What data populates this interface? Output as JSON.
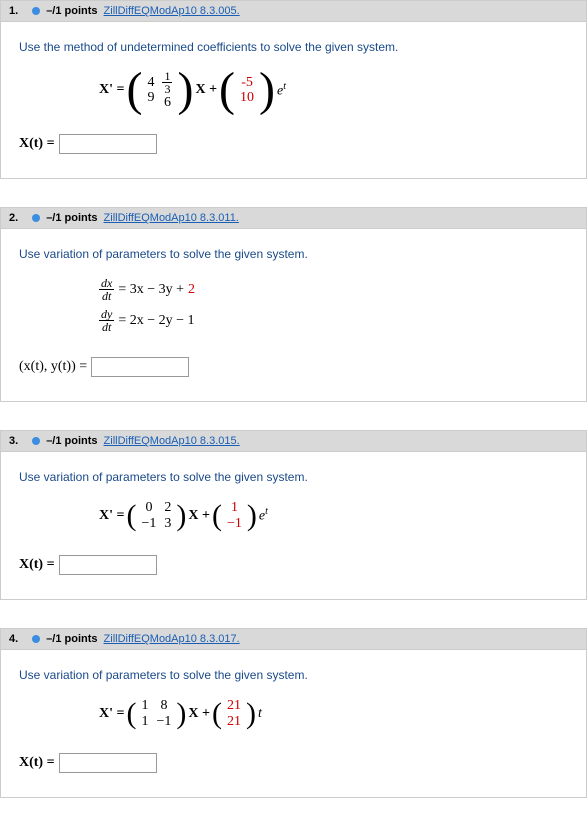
{
  "questions": [
    {
      "number": "1.",
      "points": "–/1 points",
      "source": "ZillDiffEQModAp10 8.3.005.",
      "prompt": "Use the method of undetermined coefficients to solve the given system.",
      "matrix_a": [
        [
          "4",
          "1/3"
        ],
        [
          "9",
          "6"
        ]
      ],
      "vector_b": [
        "-5",
        "10"
      ],
      "forcing_suffix": "e",
      "forcing_exp": "t",
      "answer_label": "X(t) ="
    },
    {
      "number": "2.",
      "points": "–/1 points",
      "source": "ZillDiffEQModAp10 8.3.011.",
      "prompt": "Use variation of parameters to solve the given system.",
      "eq1_lhs_num": "dx",
      "eq1_lhs_den": "dt",
      "eq1_rhs_a": "= 3x − 3y + ",
      "eq1_rhs_b": "2",
      "eq2_lhs_num": "dy",
      "eq2_lhs_den": "dt",
      "eq2_rhs_a": "= 2x − 2y − 1",
      "answer_label": "(x(t), y(t)) ="
    },
    {
      "number": "3.",
      "points": "–/1 points",
      "source": "ZillDiffEQModAp10 8.3.015.",
      "prompt": "Use variation of parameters to solve the given system.",
      "matrix_a": [
        [
          "0",
          "2"
        ],
        [
          "−1",
          "3"
        ]
      ],
      "vector_b": [
        "1",
        "−1"
      ],
      "forcing_suffix": "e",
      "forcing_exp": "t",
      "answer_label": "X(t) ="
    },
    {
      "number": "4.",
      "points": "–/1 points",
      "source": "ZillDiffEQModAp10 8.3.017.",
      "prompt": "Use variation of parameters to solve the given system.",
      "matrix_a": [
        [
          "1",
          "8"
        ],
        [
          "1",
          "−1"
        ]
      ],
      "vector_b": [
        "21",
        "21"
      ],
      "forcing_suffix": "t",
      "answer_label": "X(t) ="
    }
  ],
  "common": {
    "xprime": "X' =",
    "xvar": "X +"
  }
}
